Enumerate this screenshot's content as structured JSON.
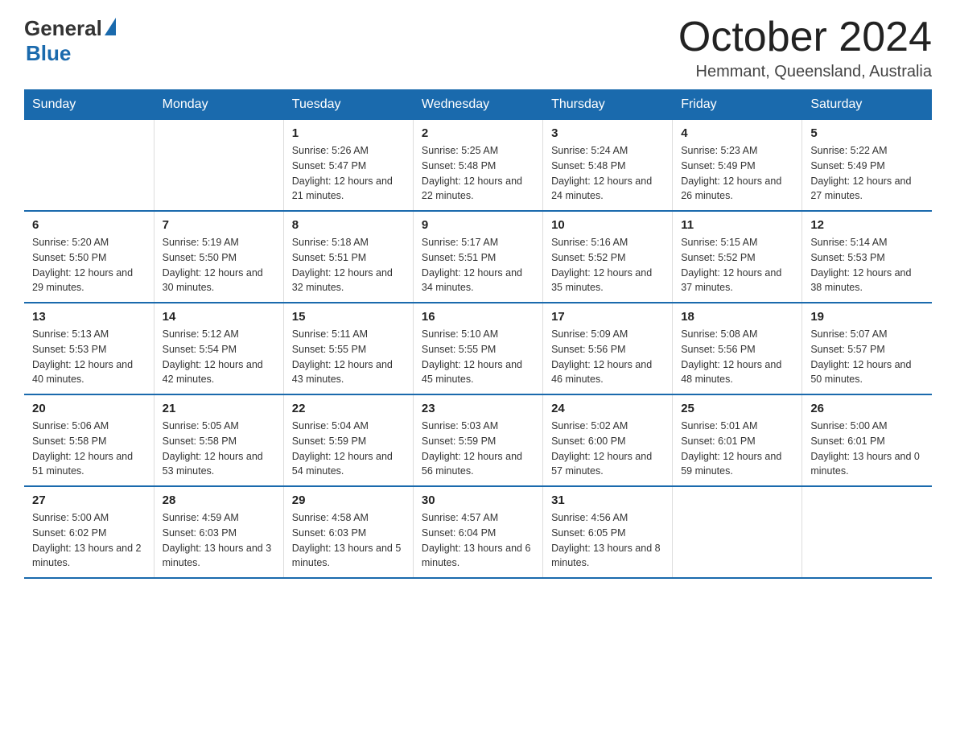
{
  "logo": {
    "text_general": "General",
    "text_blue": "Blue"
  },
  "title": {
    "month_year": "October 2024",
    "location": "Hemmant, Queensland, Australia"
  },
  "days_of_week": [
    "Sunday",
    "Monday",
    "Tuesday",
    "Wednesday",
    "Thursday",
    "Friday",
    "Saturday"
  ],
  "weeks": [
    [
      {
        "day": "",
        "sunrise": "",
        "sunset": "",
        "daylight": ""
      },
      {
        "day": "",
        "sunrise": "",
        "sunset": "",
        "daylight": ""
      },
      {
        "day": "1",
        "sunrise": "Sunrise: 5:26 AM",
        "sunset": "Sunset: 5:47 PM",
        "daylight": "Daylight: 12 hours and 21 minutes."
      },
      {
        "day": "2",
        "sunrise": "Sunrise: 5:25 AM",
        "sunset": "Sunset: 5:48 PM",
        "daylight": "Daylight: 12 hours and 22 minutes."
      },
      {
        "day": "3",
        "sunrise": "Sunrise: 5:24 AM",
        "sunset": "Sunset: 5:48 PM",
        "daylight": "Daylight: 12 hours and 24 minutes."
      },
      {
        "day": "4",
        "sunrise": "Sunrise: 5:23 AM",
        "sunset": "Sunset: 5:49 PM",
        "daylight": "Daylight: 12 hours and 26 minutes."
      },
      {
        "day": "5",
        "sunrise": "Sunrise: 5:22 AM",
        "sunset": "Sunset: 5:49 PM",
        "daylight": "Daylight: 12 hours and 27 minutes."
      }
    ],
    [
      {
        "day": "6",
        "sunrise": "Sunrise: 5:20 AM",
        "sunset": "Sunset: 5:50 PM",
        "daylight": "Daylight: 12 hours and 29 minutes."
      },
      {
        "day": "7",
        "sunrise": "Sunrise: 5:19 AM",
        "sunset": "Sunset: 5:50 PM",
        "daylight": "Daylight: 12 hours and 30 minutes."
      },
      {
        "day": "8",
        "sunrise": "Sunrise: 5:18 AM",
        "sunset": "Sunset: 5:51 PM",
        "daylight": "Daylight: 12 hours and 32 minutes."
      },
      {
        "day": "9",
        "sunrise": "Sunrise: 5:17 AM",
        "sunset": "Sunset: 5:51 PM",
        "daylight": "Daylight: 12 hours and 34 minutes."
      },
      {
        "day": "10",
        "sunrise": "Sunrise: 5:16 AM",
        "sunset": "Sunset: 5:52 PM",
        "daylight": "Daylight: 12 hours and 35 minutes."
      },
      {
        "day": "11",
        "sunrise": "Sunrise: 5:15 AM",
        "sunset": "Sunset: 5:52 PM",
        "daylight": "Daylight: 12 hours and 37 minutes."
      },
      {
        "day": "12",
        "sunrise": "Sunrise: 5:14 AM",
        "sunset": "Sunset: 5:53 PM",
        "daylight": "Daylight: 12 hours and 38 minutes."
      }
    ],
    [
      {
        "day": "13",
        "sunrise": "Sunrise: 5:13 AM",
        "sunset": "Sunset: 5:53 PM",
        "daylight": "Daylight: 12 hours and 40 minutes."
      },
      {
        "day": "14",
        "sunrise": "Sunrise: 5:12 AM",
        "sunset": "Sunset: 5:54 PM",
        "daylight": "Daylight: 12 hours and 42 minutes."
      },
      {
        "day": "15",
        "sunrise": "Sunrise: 5:11 AM",
        "sunset": "Sunset: 5:55 PM",
        "daylight": "Daylight: 12 hours and 43 minutes."
      },
      {
        "day": "16",
        "sunrise": "Sunrise: 5:10 AM",
        "sunset": "Sunset: 5:55 PM",
        "daylight": "Daylight: 12 hours and 45 minutes."
      },
      {
        "day": "17",
        "sunrise": "Sunrise: 5:09 AM",
        "sunset": "Sunset: 5:56 PM",
        "daylight": "Daylight: 12 hours and 46 minutes."
      },
      {
        "day": "18",
        "sunrise": "Sunrise: 5:08 AM",
        "sunset": "Sunset: 5:56 PM",
        "daylight": "Daylight: 12 hours and 48 minutes."
      },
      {
        "day": "19",
        "sunrise": "Sunrise: 5:07 AM",
        "sunset": "Sunset: 5:57 PM",
        "daylight": "Daylight: 12 hours and 50 minutes."
      }
    ],
    [
      {
        "day": "20",
        "sunrise": "Sunrise: 5:06 AM",
        "sunset": "Sunset: 5:58 PM",
        "daylight": "Daylight: 12 hours and 51 minutes."
      },
      {
        "day": "21",
        "sunrise": "Sunrise: 5:05 AM",
        "sunset": "Sunset: 5:58 PM",
        "daylight": "Daylight: 12 hours and 53 minutes."
      },
      {
        "day": "22",
        "sunrise": "Sunrise: 5:04 AM",
        "sunset": "Sunset: 5:59 PM",
        "daylight": "Daylight: 12 hours and 54 minutes."
      },
      {
        "day": "23",
        "sunrise": "Sunrise: 5:03 AM",
        "sunset": "Sunset: 5:59 PM",
        "daylight": "Daylight: 12 hours and 56 minutes."
      },
      {
        "day": "24",
        "sunrise": "Sunrise: 5:02 AM",
        "sunset": "Sunset: 6:00 PM",
        "daylight": "Daylight: 12 hours and 57 minutes."
      },
      {
        "day": "25",
        "sunrise": "Sunrise: 5:01 AM",
        "sunset": "Sunset: 6:01 PM",
        "daylight": "Daylight: 12 hours and 59 minutes."
      },
      {
        "day": "26",
        "sunrise": "Sunrise: 5:00 AM",
        "sunset": "Sunset: 6:01 PM",
        "daylight": "Daylight: 13 hours and 0 minutes."
      }
    ],
    [
      {
        "day": "27",
        "sunrise": "Sunrise: 5:00 AM",
        "sunset": "Sunset: 6:02 PM",
        "daylight": "Daylight: 13 hours and 2 minutes."
      },
      {
        "day": "28",
        "sunrise": "Sunrise: 4:59 AM",
        "sunset": "Sunset: 6:03 PM",
        "daylight": "Daylight: 13 hours and 3 minutes."
      },
      {
        "day": "29",
        "sunrise": "Sunrise: 4:58 AM",
        "sunset": "Sunset: 6:03 PM",
        "daylight": "Daylight: 13 hours and 5 minutes."
      },
      {
        "day": "30",
        "sunrise": "Sunrise: 4:57 AM",
        "sunset": "Sunset: 6:04 PM",
        "daylight": "Daylight: 13 hours and 6 minutes."
      },
      {
        "day": "31",
        "sunrise": "Sunrise: 4:56 AM",
        "sunset": "Sunset: 6:05 PM",
        "daylight": "Daylight: 13 hours and 8 minutes."
      },
      {
        "day": "",
        "sunrise": "",
        "sunset": "",
        "daylight": ""
      },
      {
        "day": "",
        "sunrise": "",
        "sunset": "",
        "daylight": ""
      }
    ]
  ]
}
